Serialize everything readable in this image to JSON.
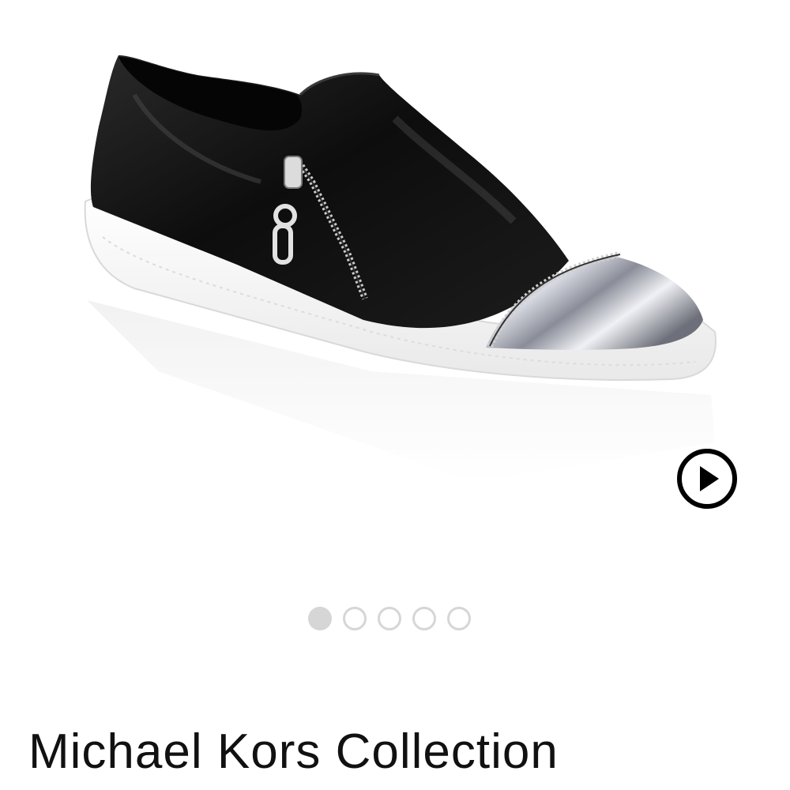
{
  "product": {
    "image_alt": "Black leather slip-on sneaker with silver metallic toe cap and side zipper",
    "brand": "Michael Kors Collection"
  },
  "gallery": {
    "total_images": 5,
    "active_index": 0
  },
  "icons": {
    "video": "play-circle-icon"
  },
  "colors": {
    "dot_active": "#d6d6d6",
    "dot_inactive_border": "#d6d6d6",
    "text": "#111111"
  }
}
